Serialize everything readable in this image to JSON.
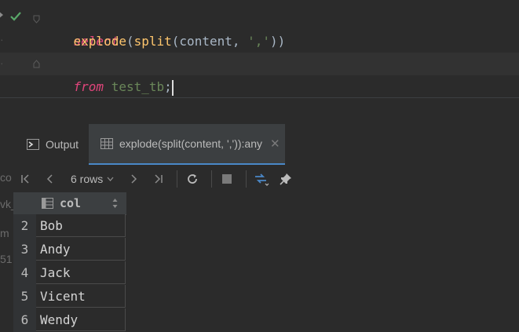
{
  "editor": {
    "lines": [
      {
        "keyword": "select"
      },
      {
        "func_outer": "explode",
        "paren1": "(",
        "func_inner": "split",
        "paren2": "(",
        "arg": "content",
        "comma": ", ",
        "str": "','",
        "close": "))"
      },
      {
        "keyword": "from",
        "table": "test_tb",
        "semi": ";"
      }
    ]
  },
  "tabs": {
    "output_label": "Output",
    "result_label": "explode(split(content, ',')):any",
    "close": "✕"
  },
  "toolbar": {
    "rows_label": "6 rows",
    "chevron": "⌄"
  },
  "side_fragments": [
    "co",
    "vk_",
    "m",
    "51"
  ],
  "grid": {
    "column": "col",
    "rows": [
      {
        "num": "2",
        "value": "Bob"
      },
      {
        "num": "3",
        "value": "Andy"
      },
      {
        "num": "4",
        "value": "Jack"
      },
      {
        "num": "5",
        "value": "Vicent"
      },
      {
        "num": "6",
        "value": "Wendy"
      }
    ]
  },
  "colors": {
    "accent": "#4a88c7",
    "keyword": "#e0457b",
    "function": "#ffc66d",
    "string": "#6a8759",
    "check": "#59a869"
  }
}
